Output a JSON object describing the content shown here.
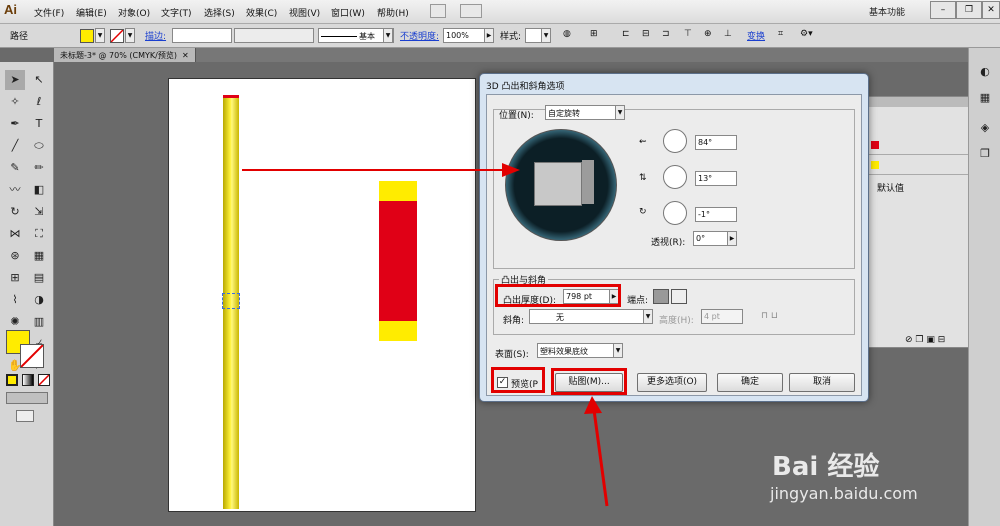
{
  "app": {
    "logo": "Ai",
    "workspace": "基本功能"
  },
  "menu": [
    "文件(F)",
    "编辑(E)",
    "对象(O)",
    "文字(T)",
    "选择(S)",
    "效果(C)",
    "视图(V)",
    "窗口(W)",
    "帮助(H)"
  ],
  "control": {
    "type_label": "路径",
    "stroke_label": "描边:",
    "brush_label": "基本",
    "opacity_label": "不透明度:",
    "opacity_value": "100%",
    "style_label": "样式:",
    "transform_label": "变换"
  },
  "document": {
    "tab": "未标题-3* @ 70% (CMYK/预览)"
  },
  "panel": {
    "default_label": "默认值"
  },
  "dialog": {
    "title": "3D 凸出和斜角选项",
    "position_label": "位置(N):",
    "position_value": "自定旋转",
    "rot_x": "84°",
    "rot_y": "13°",
    "rot_z": "-1°",
    "perspective_label": "透视(R):",
    "perspective_value": "0°",
    "extrude_group": "凸出与斜角",
    "extrude_depth_label": "凸出厚度(D):",
    "extrude_depth_value": "798 pt",
    "cap_label": "端点:",
    "bevel_label": "斜角:",
    "bevel_value": "无",
    "height_label": "高度(H):",
    "height_value": "4 pt",
    "surface_label": "表面(S):",
    "surface_value": "塑料效果底纹",
    "preview_label": "预览(P",
    "map_button": "贴图(M)...",
    "more_button": "更多选项(O)",
    "ok_button": "确定",
    "cancel_button": "取消"
  },
  "watermark": {
    "brand": "Bai 经验",
    "url": "jingyan.baidu.com"
  },
  "colors": {
    "yellow": "#ffec00",
    "red": "#e00016",
    "annotation": "#e20000"
  }
}
